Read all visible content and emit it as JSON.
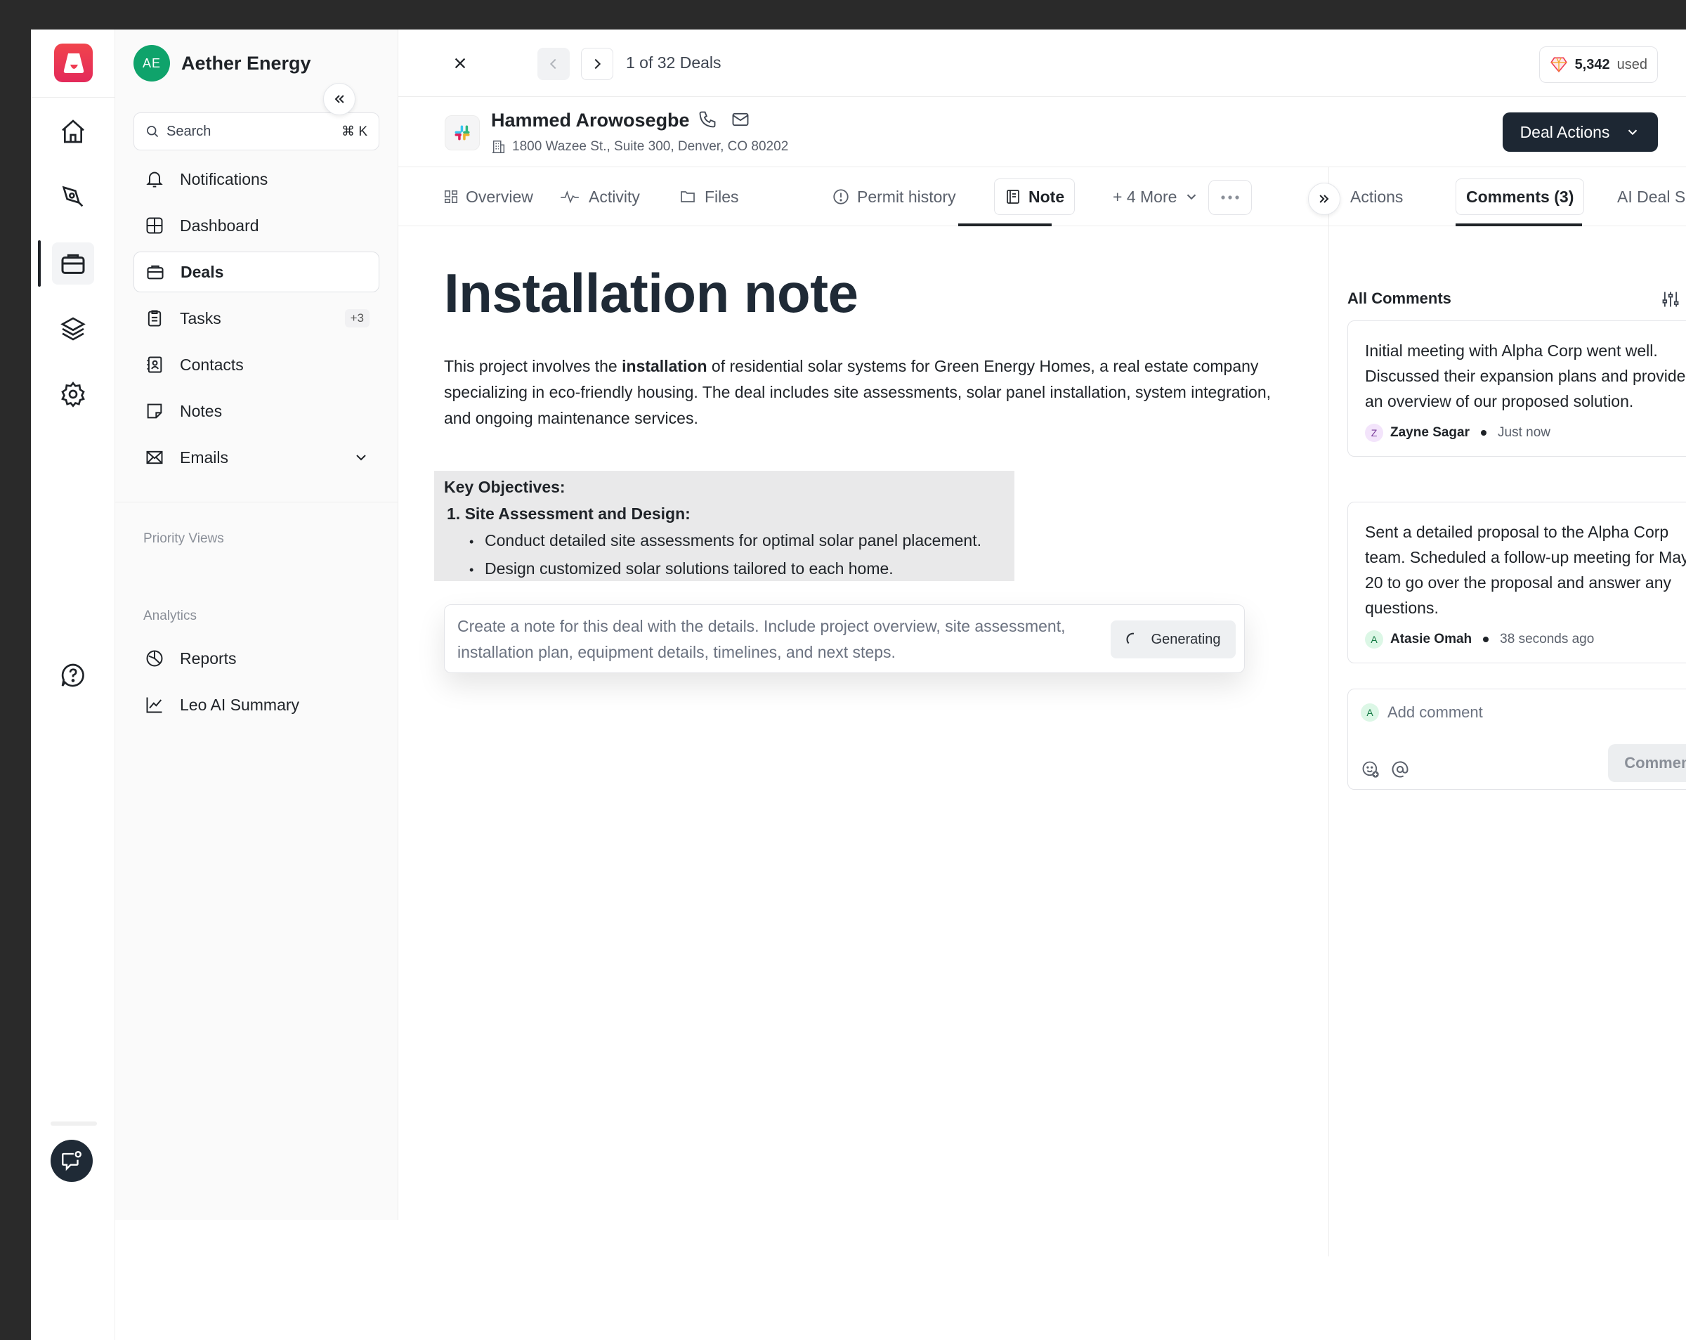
{
  "org": {
    "initials": "AE",
    "name": "Aether Energy"
  },
  "search": {
    "placeholder": "Search",
    "shortcut": "⌘ K"
  },
  "nav": {
    "notifications": "Notifications",
    "dashboard": "Dashboard",
    "deals": "Deals",
    "tasks": "Tasks",
    "tasks_badge": "+3",
    "contacts": "Contacts",
    "notes": "Notes",
    "emails": "Emails"
  },
  "sections": {
    "priority_views": "Priority Views",
    "analytics": "Analytics"
  },
  "analytics_items": {
    "reports": "Reports",
    "leo": "Leo AI Summary"
  },
  "topbar": {
    "counter": "1 of 32 Deals",
    "credits_value": "5,342",
    "credits_label": "used"
  },
  "contact": {
    "name": "Hammed Arowosegbe",
    "address": "1800 Wazee St., Suite 300, Denver, CO 80202"
  },
  "deal_actions": "Deal Actions",
  "tabs": {
    "overview": "Overview",
    "activity": "Activity",
    "files": "Files",
    "permit": "Permit history",
    "note": "Note",
    "more": "+ 4 More"
  },
  "note": {
    "title": "Installation note",
    "intro_before": "This project involves the ",
    "intro_bold": "installation",
    "intro_after": " of residential solar systems for Green Energy Homes, a real estate company specializing in eco-friendly housing. The deal includes site assessments, solar panel installation, system integration, and ongoing maintenance services.",
    "objectives_heading": "Key Objectives:",
    "step1": "1. Site Assessment and Design:",
    "bullets": [
      "Conduct detailed site assessments for optimal solar panel placement.",
      "Design customized solar solutions tailored to each home."
    ],
    "prompt": "Create a note for this deal with the details. Include project overview, site assessment, installation plan, equipment details, timelines, and next steps.",
    "generating": "Generating"
  },
  "right_tabs": {
    "actions": "Actions",
    "comments": "Comments (3)",
    "ai_scope": "AI Deal Scope"
  },
  "comments": {
    "heading": "All Comments",
    "items": [
      {
        "body": "Initial meeting with Alpha Corp went well. Discussed their expansion plans and provided an overview of our proposed solution.",
        "initial": "Z",
        "author": "Zayne Sagar",
        "time": "Just now"
      },
      {
        "body": "Sent a detailed proposal to the Alpha Corp team. Scheduled a follow-up meeting for May 20 to go over the proposal and answer any questions.",
        "initial": "A",
        "author": "Atasie Omah",
        "time": "38 seconds ago"
      }
    ],
    "add_initial": "A",
    "add_placeholder": "Add comment",
    "comment_button": "Comment"
  },
  "colors": {
    "brand": "#ef3b52",
    "accent_dark": "#1d2733",
    "avatar_green": "#0fa36b"
  }
}
